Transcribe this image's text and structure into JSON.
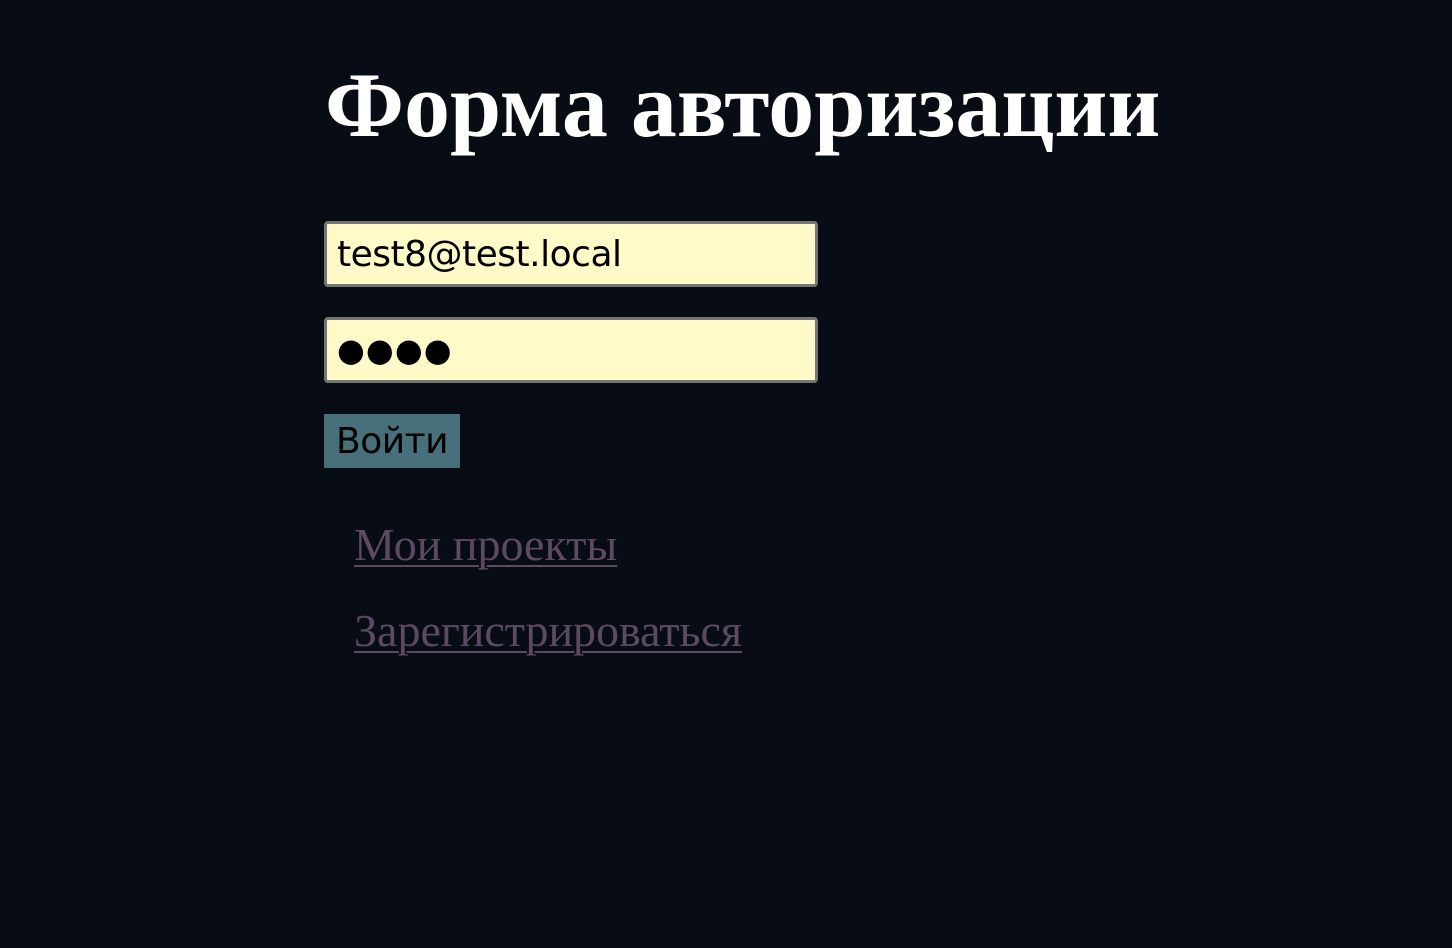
{
  "colors": {
    "background": "#080c14",
    "title": "#ffffff",
    "input_background": "#fffac8",
    "input_border": "#767676",
    "button_background": "#48707a",
    "link": "#5c4a62"
  },
  "login_form": {
    "title": "Форма авторизации",
    "email_value": "test8@test.local",
    "password_mask": "●●●●",
    "submit_label": "Войти"
  },
  "links": {
    "projects": "Мои проекты",
    "register": "Зарегистрироваться"
  }
}
